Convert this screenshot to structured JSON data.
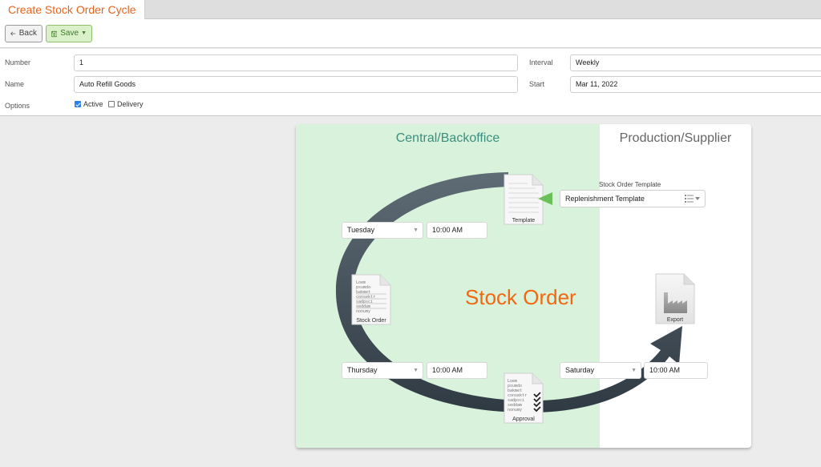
{
  "tab": {
    "title": "Create Stock Order Cycle"
  },
  "toolbar": {
    "back_label": "Back",
    "save_label": "Save"
  },
  "form": {
    "number": {
      "label": "Number",
      "value": "1"
    },
    "name": {
      "label": "Name",
      "value": "Auto Refill Goods"
    },
    "options": {
      "label": "Options",
      "active": {
        "label": "Active",
        "checked": true
      },
      "delivery": {
        "label": "Delivery",
        "checked": false
      }
    },
    "interval": {
      "label": "Interval",
      "value": "Weekly"
    },
    "start": {
      "label": "Start",
      "value": "Mar 11, 2022"
    }
  },
  "diagram": {
    "zones": {
      "central": "Central/Backoffice",
      "production": "Production/Supplier"
    },
    "center_title": "Stock Order",
    "template": {
      "label": "Stock Order Template",
      "value": "Replenishment Template"
    },
    "docs": {
      "template": "Template",
      "stock_order": "Stock Order",
      "approval": "Approval",
      "export": "Export"
    },
    "schedules": {
      "stock_order": {
        "day": "Tuesday",
        "time": "10:00 AM"
      },
      "approval": {
        "day": "Thursday",
        "time": "10:00 AM"
      },
      "export": {
        "day": "Saturday",
        "time": "10:00 AM"
      }
    },
    "colors": {
      "accent": "#e8641b",
      "central_bg": "#d9f2dc",
      "ring": "#3b4650",
      "pointer": "#6cc05a"
    }
  }
}
